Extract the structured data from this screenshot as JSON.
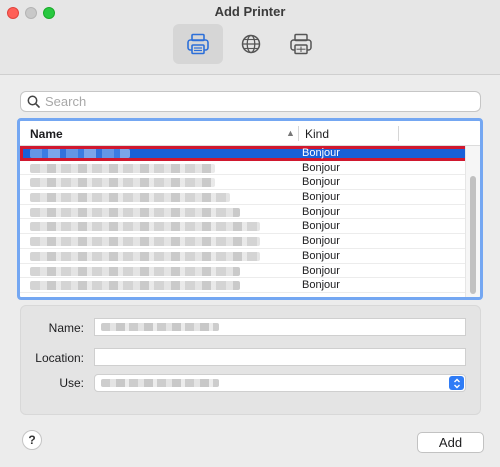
{
  "window": {
    "title": "Add Printer"
  },
  "toolbar": {
    "buttons": [
      {
        "icon": "default-printer-icon",
        "active": true
      },
      {
        "icon": "ip-globe-icon",
        "active": false
      },
      {
        "icon": "windows-printer-icon",
        "active": false
      }
    ]
  },
  "search": {
    "placeholder": "Search",
    "value": ""
  },
  "printer_list": {
    "columns": {
      "name": "Name",
      "kind": "Kind"
    },
    "selected_index": 0,
    "rows": [
      {
        "kind": "Bonjour"
      },
      {
        "kind": "Bonjour"
      },
      {
        "kind": "Bonjour"
      },
      {
        "kind": "Bonjour"
      },
      {
        "kind": "Bonjour"
      },
      {
        "kind": "Bonjour"
      },
      {
        "kind": "Bonjour"
      },
      {
        "kind": "Bonjour"
      },
      {
        "kind": "Bonjour"
      },
      {
        "kind": "Bonjour"
      }
    ]
  },
  "form": {
    "name_label": "Name:",
    "location_label": "Location:",
    "location_value": "",
    "use_label": "Use:"
  },
  "footer": {
    "help_label": "?",
    "add_label": "Add"
  },
  "colors": {
    "accent": "#1860d9",
    "selection_outline": "#d0182f",
    "focus_ring": "#74a7f2"
  }
}
